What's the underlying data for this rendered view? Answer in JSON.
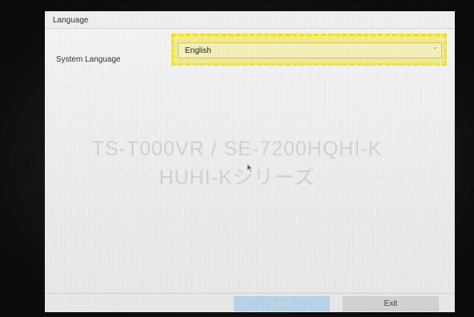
{
  "dialog": {
    "title": "Language",
    "setting_label": "System Language",
    "language_select": {
      "selected_value": "English",
      "arrow": "-"
    }
  },
  "watermark": {
    "line1": "TS-T000VR / SE-7200HQHI-K",
    "line2": "HUHI-Kシリーズ"
  },
  "footer": {
    "apply_label": "Apply",
    "exit_label": "Exit"
  },
  "colors": {
    "highlight": "#f1e31a",
    "apply_button": "#b7d3e6",
    "exit_button": "#d2d2d2"
  }
}
